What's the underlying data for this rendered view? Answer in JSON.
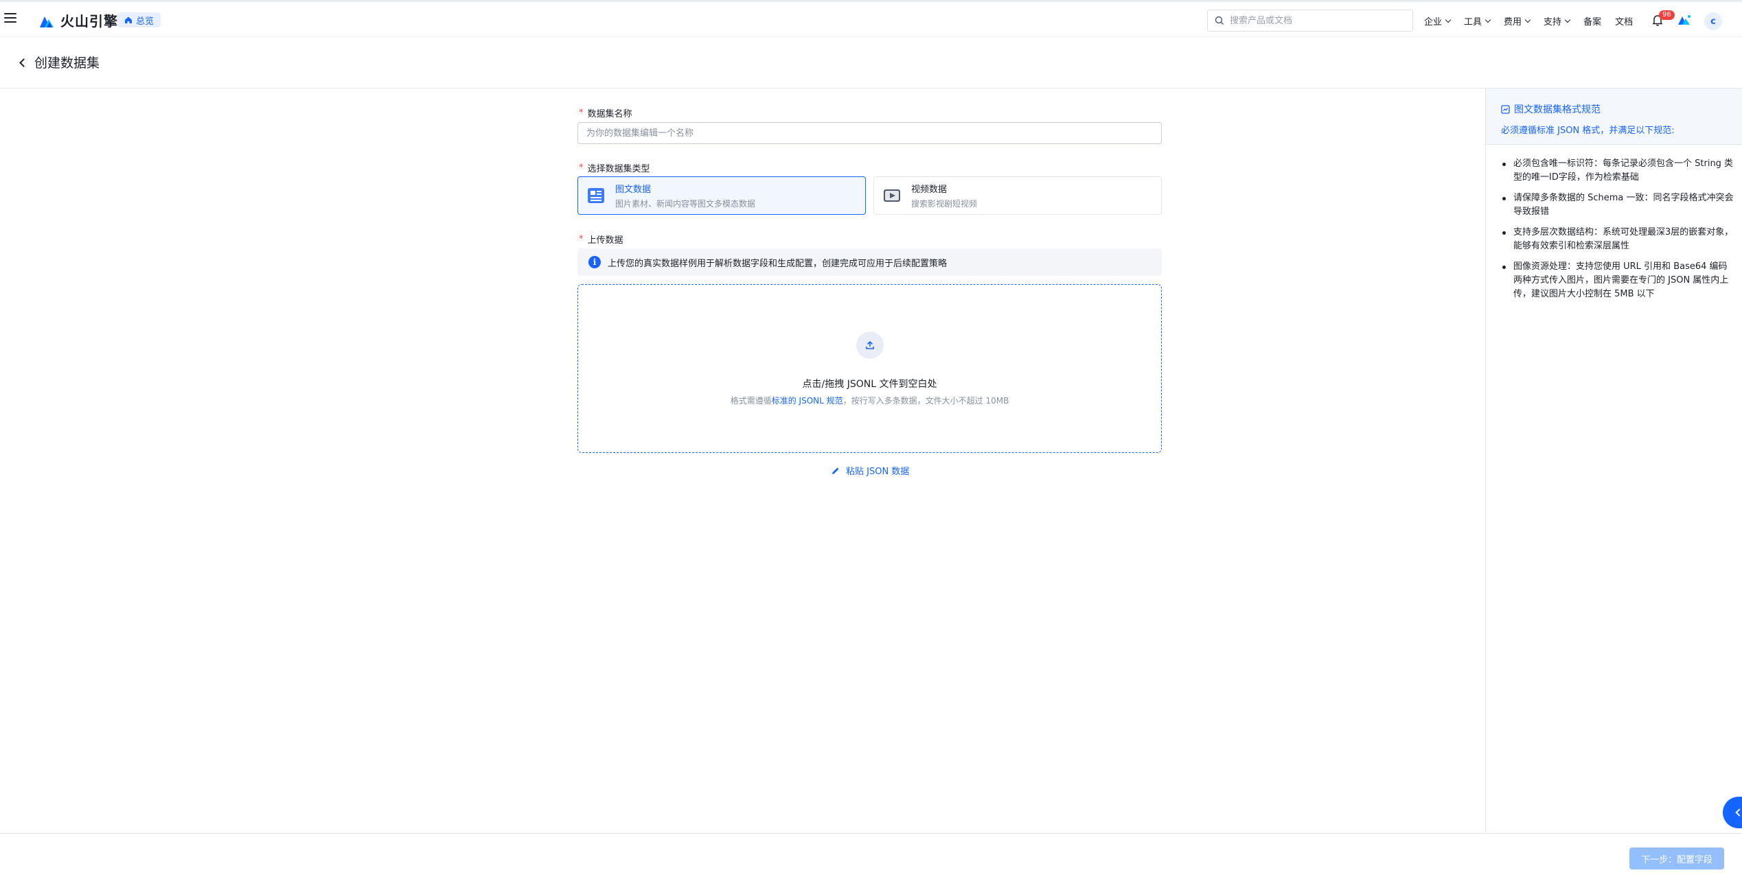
{
  "topnav": {
    "brand": "火山引擎",
    "overview": "总览",
    "search_placeholder": "搜索产品或文档",
    "menu": [
      {
        "label": "企业",
        "has_dropdown": true
      },
      {
        "label": "工具",
        "has_dropdown": true
      },
      {
        "label": "费用",
        "has_dropdown": true
      },
      {
        "label": "支持",
        "has_dropdown": true
      },
      {
        "label": "备案",
        "has_dropdown": false
      },
      {
        "label": "文档",
        "has_dropdown": false
      }
    ],
    "notification_count": "96",
    "avatar_initial": "c"
  },
  "page": {
    "title": "创建数据集"
  },
  "form": {
    "name_label": "数据集名称",
    "name_placeholder": "为你的数据集编辑一个名称",
    "type_label": "选择数据集类型",
    "types": [
      {
        "name": "图文数据",
        "desc": "图片素材、新闻内容等图文多模态数据",
        "selected": true
      },
      {
        "name": "视频数据",
        "desc": "搜索影视剧短视频",
        "selected": false
      }
    ],
    "upload_label": "上传数据",
    "upload_info": "上传您的真实数据样例用于解析数据字段和生成配置，创建完成可应用于后续配置策略",
    "dropzone_title": "点击/拖拽 JSONL 文件到空白处",
    "dropzone_sub_prefix": "格式需遵循",
    "dropzone_sub_link": "标准的 JSONL 规范",
    "dropzone_sub_suffix": "，按行写入多条数据，文件大小不超过 10MB",
    "paste_label": "粘贴 JSON 数据"
  },
  "right_panel": {
    "title": "图文数据集格式规范",
    "subtitle": "必须遵循标准 JSON 格式，并满足以下规范:",
    "rules": [
      "必须包含唯一标识符：每条记录必须包含一个 String 类型的唯一ID字段，作为检索基础",
      "请保障多条数据的 Schema 一致：同名字段格式冲突会导致报错",
      "支持多层次数据结构：系统可处理最深3层的嵌套对象，能够有效索引和检索深层属性",
      "图像资源处理：支持您使用 URL 引用和 Base64 编码两种方式传入图片，图片需要在专门的 JSON 属性内上传，建议图片大小控制在 5MB 以下"
    ]
  },
  "footer": {
    "next_label": "下一步：配置字段"
  },
  "colors": {
    "accent": "#1664ff",
    "required": "#f53f3f",
    "disabled_button": "#94bfff"
  }
}
